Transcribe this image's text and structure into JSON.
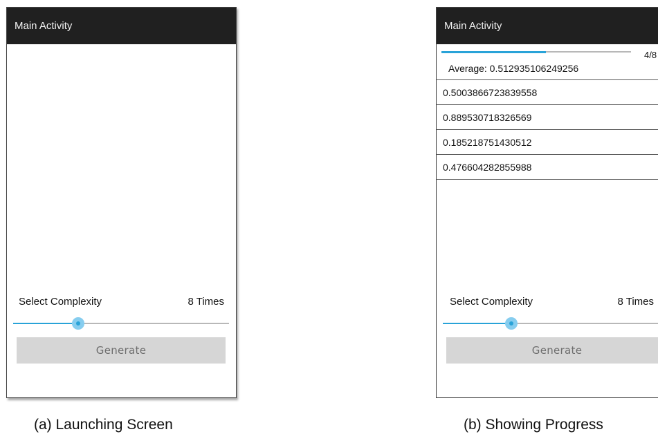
{
  "screen_a": {
    "app_title": "Main Activity",
    "complexity_label": "Select Complexity",
    "complexity_value": "8 Times",
    "slider_fraction": 0.3,
    "generate_label": "Generate"
  },
  "screen_b": {
    "app_title": "Main Activity",
    "progress_text": "4/8",
    "progress_fraction": 0.55,
    "average_text": "Average: 0.512935106249256",
    "results": [
      "0.5003866723839558",
      "0.889530718326569",
      "0.185218751430512",
      "0.476604282855988"
    ],
    "complexity_label": "Select Complexity",
    "complexity_value": "8 Times",
    "slider_fraction": 0.3,
    "generate_label": "Generate"
  },
  "captions": {
    "a": "(a) Launching Screen",
    "b": "(b) Showing Progress"
  },
  "colors": {
    "app_bar": "#202020",
    "accent": "#29a3d8",
    "thumb": "#86cdef",
    "button_bg": "#d6d6d6"
  }
}
